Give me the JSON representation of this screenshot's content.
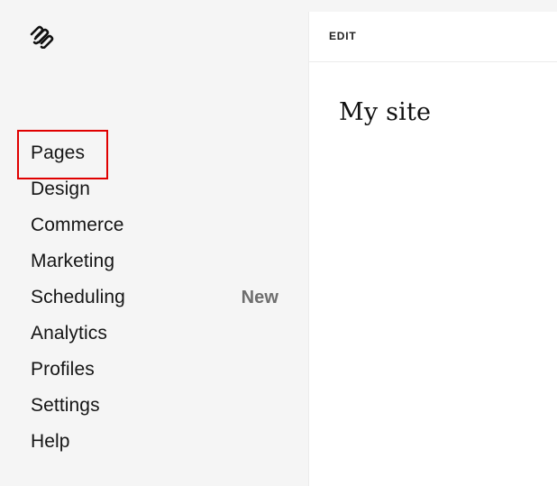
{
  "sidebar": {
    "logo_icon": "squarespace-logo-icon",
    "items": [
      {
        "label": "Pages",
        "badge": ""
      },
      {
        "label": "Design",
        "badge": ""
      },
      {
        "label": "Commerce",
        "badge": ""
      },
      {
        "label": "Marketing",
        "badge": ""
      },
      {
        "label": "Scheduling",
        "badge": "New"
      },
      {
        "label": "Analytics",
        "badge": ""
      },
      {
        "label": "Profiles",
        "badge": ""
      },
      {
        "label": "Settings",
        "badge": ""
      },
      {
        "label": "Help",
        "badge": ""
      }
    ],
    "highlight_color": "#e00000"
  },
  "preview": {
    "edit_label": "EDIT",
    "site_title": "My site"
  }
}
